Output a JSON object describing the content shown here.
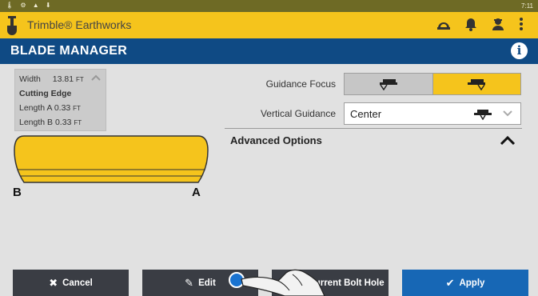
{
  "statusbar": {
    "icons": "🌡 ⚙ ▲ ⬇",
    "time": "7:11"
  },
  "appbar": {
    "title": "Trimble® Earthworks",
    "icons": [
      "hardhat-icon",
      "bell-icon",
      "user-icon",
      "more-icon"
    ]
  },
  "header": {
    "title": "BLADE MANAGER",
    "info": "i"
  },
  "blade": {
    "width_label": "Width",
    "width_value": "13.81",
    "width_unit": "FT",
    "cutting_edge": "Cutting Edge",
    "length_a_label": "Length A",
    "length_a_value": "0.33",
    "length_a_unit": "FT",
    "length_b_label": "Length B",
    "length_b_value": "0.33",
    "length_b_unit": "FT",
    "end_left": "B",
    "end_right": "A"
  },
  "settings": {
    "guidance_focus_label": "Guidance Focus",
    "vertical_guidance_label": "Vertical Guidance",
    "vertical_guidance_value": "Center",
    "advanced_label": "Advanced Options"
  },
  "buttons": {
    "cancel": "Cancel",
    "edit": "Edit",
    "bolt": "Current Bolt Hole",
    "apply": "Apply"
  },
  "colors": {
    "brand_yellow": "#f5c41c",
    "header_blue": "#0f4a84",
    "apply_blue": "#1767b5",
    "dark_button": "#3a3d44"
  }
}
